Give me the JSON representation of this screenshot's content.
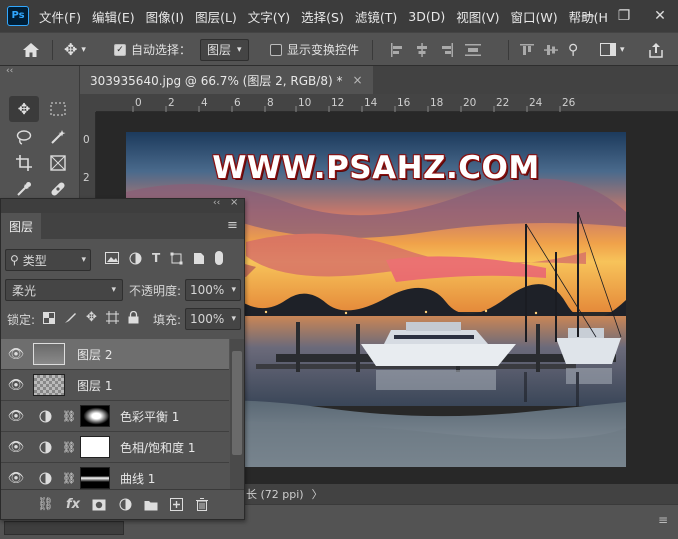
{
  "app": {
    "logo": "Ps"
  },
  "menu": [
    "文件(F)",
    "编辑(E)",
    "图像(I)",
    "图层(L)",
    "文字(Y)",
    "选择(S)",
    "滤镜(T)",
    "3D(D)",
    "视图(V)",
    "窗口(W)",
    "帮助(H"
  ],
  "window_controls": {
    "minimize": "—",
    "restore": "❐",
    "close": "✕"
  },
  "options": {
    "auto_select_label": "自动选择：",
    "auto_select_checked": true,
    "auto_select_target": "图层",
    "show_transform_label": "显示变换控件",
    "show_transform_checked": false
  },
  "document": {
    "tab_title": "303935640.jpg @ 66.7% (图层 2, RGB/8) *",
    "close": "×",
    "watermark": "WWW.PSAHZ.COM",
    "status": "长 (72 ppi)",
    "status_arrow": "〉"
  },
  "ruler": {
    "h_ticks": [
      "0",
      "2",
      "4",
      "6",
      "8",
      "10",
      "12",
      "14",
      "16",
      "18",
      "20",
      "22",
      "24",
      "26"
    ],
    "v_ticks": [
      "0",
      "2"
    ]
  },
  "layers_panel": {
    "tab": "图层",
    "filter_label": "类型",
    "blend_mode": "柔光",
    "opacity_label": "不透明度:",
    "opacity_value": "100%",
    "lock_label": "锁定:",
    "fill_label": "填充:",
    "fill_value": "100%",
    "layers": [
      {
        "name": "图层 2",
        "type": "pixel",
        "selected": true
      },
      {
        "name": "图层 1",
        "type": "pixel",
        "selected": false
      },
      {
        "name": "色彩平衡 1",
        "type": "adjustment",
        "selected": false
      },
      {
        "name": "色相/饱和度 1",
        "type": "adjustment",
        "selected": false
      },
      {
        "name": "曲线 1",
        "type": "adjustment",
        "selected": false
      }
    ],
    "footer_icons": [
      "link-icon",
      "fx-icon",
      "mask-icon",
      "adjustment-icon",
      "group-icon",
      "new-layer-icon",
      "trash-icon"
    ],
    "fx_label": "fx"
  },
  "colors": {
    "accent": "#31a8ff",
    "chrome_dark": "#3c3c3c",
    "panel": "#535353",
    "canvas_bg": "#282828",
    "watermark_outline": "#8a1010"
  }
}
